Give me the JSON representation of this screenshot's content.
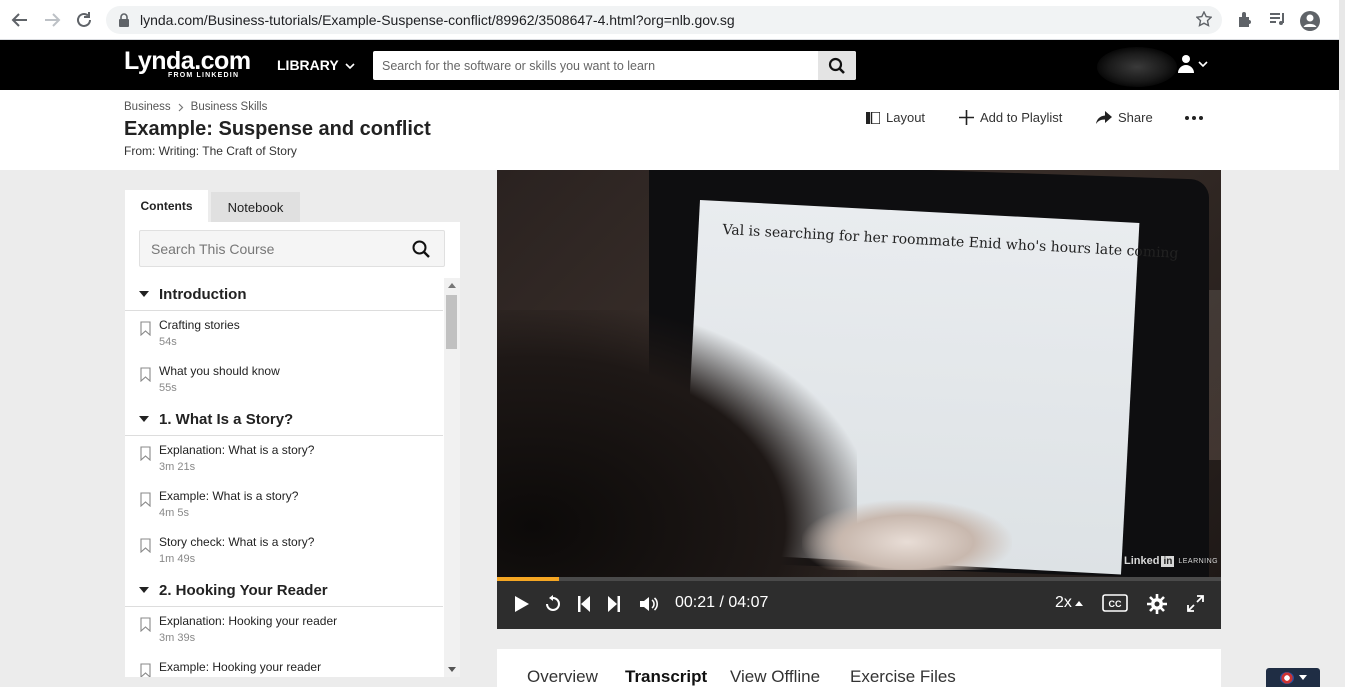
{
  "browser": {
    "url": "lynda.com/Business-tutorials/Example-Suspense-conflict/89962/3508647-4.html?org=nlb.gov.sg"
  },
  "topnav": {
    "logo": "Lynda.com",
    "logo_sub": "FROM LINKEDIN",
    "library_label": "LIBRARY",
    "search_placeholder": "Search for the software or skills you want to learn"
  },
  "header": {
    "breadcrumbs": [
      "Business",
      "Business Skills"
    ],
    "title": "Example: Suspense and conflict",
    "from": "From: Writing: The Craft of Story",
    "actions": {
      "layout": "Layout",
      "add_to_playlist": "Add to Playlist",
      "share": "Share"
    }
  },
  "sidebar": {
    "tabs": [
      "Contents",
      "Notebook"
    ],
    "search_placeholder": "Search This Course",
    "sections": [
      {
        "title": "Introduction",
        "items": [
          {
            "title": "Crafting stories",
            "duration": "54s"
          },
          {
            "title": "What you should know",
            "duration": "55s"
          }
        ]
      },
      {
        "title": "1. What Is a Story?",
        "items": [
          {
            "title": "Explanation: What is a story?",
            "duration": "3m 21s"
          },
          {
            "title": "Example: What is a story?",
            "duration": "4m 5s"
          },
          {
            "title": "Story check: What is a story?",
            "duration": "1m 49s"
          }
        ]
      },
      {
        "title": "2. Hooking Your Reader",
        "items": [
          {
            "title": "Explanation: Hooking your reader",
            "duration": "3m 39s"
          },
          {
            "title": "Example: Hooking your reader",
            "duration": ""
          }
        ]
      }
    ]
  },
  "video": {
    "screen_text": "Val is searching for her roommate Enid who's hours late coming",
    "watermark_brand": "Linked",
    "watermark_in": "in",
    "watermark_learning": "LEARNING",
    "time": "00:21 / 04:07",
    "progress_fraction": 0.085,
    "speed": "2x",
    "cc_label": "CC",
    "accent_color": "#f5a623"
  },
  "content_tabs": [
    "Overview",
    "Transcript",
    "View Offline",
    "Exercise Files"
  ],
  "active_content_tab": "Transcript"
}
